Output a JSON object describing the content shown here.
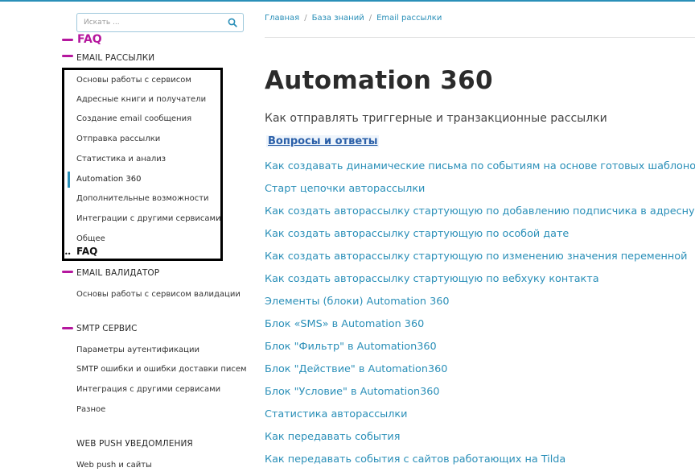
{
  "search": {
    "placeholder": "Искать ..."
  },
  "annotations": {
    "faq_top": "FAQ",
    "faq_mid": "FAQ",
    "dots": "••"
  },
  "sections": {
    "email_mailings": {
      "title": "EMAIL РАССЫЛКИ",
      "items": [
        "Основы работы с сервисом",
        "Адресные книги и получатели",
        "Создание email сообщения",
        "Отправка рассылки",
        "Статистика и анализ",
        "Automation 360",
        "Дополнительные возможности",
        "Интеграции с другими сервисами",
        "Общее"
      ],
      "active_item": "Automation 360"
    },
    "email_validator": {
      "title": "EMAIL ВАЛИДАТОР",
      "items": [
        "Основы работы с сервисом валидации"
      ]
    },
    "smtp": {
      "title": "SMTP СЕРВИС",
      "items": [
        "Параметры аутентификации",
        "SMTP ошибки и ошибки доставки писем",
        "Интеграция с другими сервисами",
        "Разное"
      ]
    },
    "web_push": {
      "title": "WEB PUSH УВЕДОМЛЕНИЯ",
      "items": [
        "Web push и сайты"
      ]
    }
  },
  "breadcrumb": [
    "Главная",
    "База знаний",
    "Email рассылки"
  ],
  "breadcrumb_separator": "/",
  "main": {
    "title": "Automation 360",
    "subtitle": "Как отправлять триггерные и транзакционные рассылки",
    "qa_heading": "Вопросы и ответы",
    "articles": [
      "Как создавать динамические письма по событиям на основе готовых шаблонов S",
      "Старт цепочки авторассылки",
      "Как создать авторассылку стартующую по добавлению подписчика в адресную к",
      "Как создать авторассылку стартующую по особой дате",
      "Как создать авторассылку стартующую по изменению значения переменной",
      "Как создать авторассылку стартующую по вебхуку контакта",
      "Элементы (блоки) Automation 360",
      "Блок «SMS» в Automation 360",
      "Блок \"Фильтр\" в Automation360",
      "Блок \"Действие\" в Automation360",
      "Блок \"Условие\" в Automation360",
      "Статистика авторассылки",
      "Как передавать события",
      "Как передавать события с сайтов работающих на Tilda"
    ]
  },
  "colors": {
    "accent": "#2a8fb8",
    "annotation": "#b5179e",
    "annotation_box": "#000000"
  },
  "icons": {
    "search_button": "search-icon"
  }
}
